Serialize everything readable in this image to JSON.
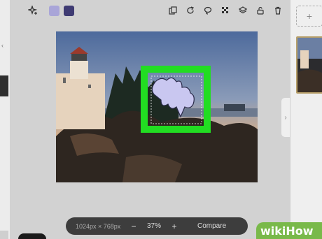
{
  "toolbar": {
    "swatch_colors": [
      "#a9a5d8",
      "#3f3b73"
    ],
    "icons": [
      "sparkle-add-icon",
      "duplicate-icon",
      "redo-icon",
      "lasso-icon",
      "transparency-icon",
      "layers-icon",
      "unlock-icon",
      "delete-icon"
    ]
  },
  "status_bar": {
    "dimensions": "1024px × 768px",
    "zoom_out_label": "−",
    "zoom_level": "37%",
    "zoom_in_label": "+",
    "compare_label": "Compare"
  },
  "highlight_color": "#22dd22",
  "watermark": "wikiHow"
}
